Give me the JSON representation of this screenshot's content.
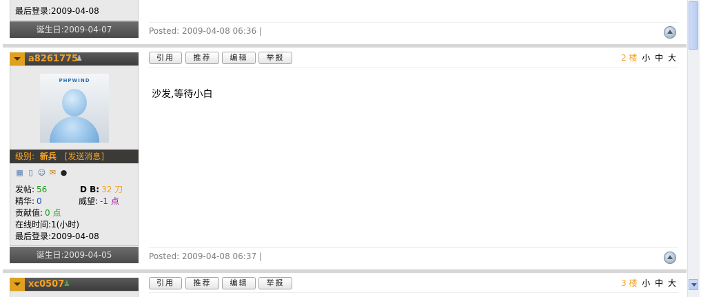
{
  "post_prev": {
    "last_login": "最后登录:2009-04-08",
    "birthday": "诞生日:2009-04-07",
    "posted": "Posted: 2009-04-08 06:36 |"
  },
  "post2": {
    "username": "a8261775",
    "buttons": [
      "引用",
      "推荐",
      "编辑",
      "举报"
    ],
    "floor_number": "2 楼",
    "font_sizes": [
      "小",
      "中",
      "大"
    ],
    "avatar_text": "PHPWIND",
    "rank_label": "级别:",
    "rank_value": "新兵",
    "send_message": "[发送消息]",
    "stats": {
      "posts_label": "发帖:",
      "posts_value": "56",
      "db_label": "D B:",
      "db_value": "32 刀",
      "digest_label": "精华:",
      "digest_value": "0",
      "prestige_label": "威望:",
      "prestige_value": "-1 点",
      "contribution_label": "贡献值:",
      "contribution_value": "0 点",
      "online_time": "在线时间:1(小时)",
      "last_login": "最后登录:2009-04-08"
    },
    "birthday": "诞生日:2009-04-05",
    "content": "沙发,等待小白",
    "posted": "Posted: 2009-04-08 06:37 |"
  },
  "post3": {
    "username": "xc0507",
    "buttons": [
      "引用",
      "推荐",
      "编辑",
      "举报"
    ],
    "floor_number": "3 楼",
    "font_sizes": [
      "小",
      "中",
      "大"
    ]
  },
  "colors": {
    "accent": "#f2a323",
    "header_bg": "#3c3a37",
    "sidebar_bg": "#e9e9e9"
  }
}
